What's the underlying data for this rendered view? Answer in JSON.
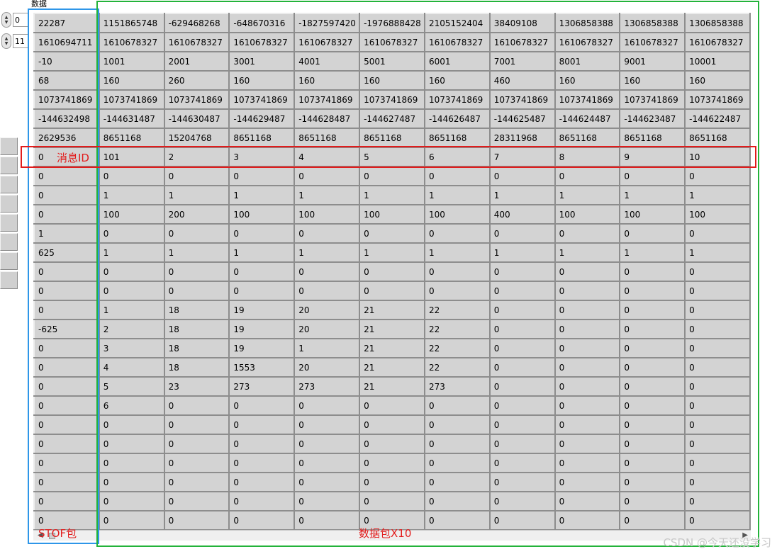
{
  "array": {
    "label": "数据",
    "row_index": "0",
    "col_index": "11"
  },
  "annotations": {
    "message_id": "消息ID",
    "stof_packet": "STOF包",
    "data_packets": "数据包X10"
  },
  "watermark": "CSDN @今天还没学习",
  "rows": [
    [
      "22287",
      "1151865748",
      "-629468268",
      "-648670316",
      "-1827597420",
      "-1976888428",
      "2105152404",
      "38409108",
      "1306858388",
      "1306858388",
      "1306858388"
    ],
    [
      "1610694711",
      "1610678327",
      "1610678327",
      "1610678327",
      "1610678327",
      "1610678327",
      "1610678327",
      "1610678327",
      "1610678327",
      "1610678327",
      "1610678327"
    ],
    [
      "-10",
      "1001",
      "2001",
      "3001",
      "4001",
      "5001",
      "6001",
      "7001",
      "8001",
      "9001",
      "10001"
    ],
    [
      "68",
      "160",
      "260",
      "160",
      "160",
      "160",
      "160",
      "460",
      "160",
      "160",
      "160"
    ],
    [
      "1073741869",
      "1073741869",
      "1073741869",
      "1073741869",
      "1073741869",
      "1073741869",
      "1073741869",
      "1073741869",
      "1073741869",
      "1073741869",
      "1073741869"
    ],
    [
      "-144632498",
      "-144631487",
      "-144630487",
      "-144629487",
      "-144628487",
      "-144627487",
      "-144626487",
      "-144625487",
      "-144624487",
      "-144623487",
      "-144622487"
    ],
    [
      "2629536",
      "8651168",
      "15204768",
      "8651168",
      "8651168",
      "8651168",
      "8651168",
      "28311968",
      "8651168",
      "8651168",
      "8651168"
    ],
    [
      "0",
      "101",
      "2",
      "3",
      "4",
      "5",
      "6",
      "7",
      "8",
      "9",
      "10"
    ],
    [
      "0",
      "0",
      "0",
      "0",
      "0",
      "0",
      "0",
      "0",
      "0",
      "0",
      "0"
    ],
    [
      "0",
      "1",
      "1",
      "1",
      "1",
      "1",
      "1",
      "1",
      "1",
      "1",
      "1"
    ],
    [
      "0",
      "100",
      "200",
      "100",
      "100",
      "100",
      "100",
      "400",
      "100",
      "100",
      "100"
    ],
    [
      "1",
      "0",
      "0",
      "0",
      "0",
      "0",
      "0",
      "0",
      "0",
      "0",
      "0"
    ],
    [
      "625",
      "1",
      "1",
      "1",
      "1",
      "1",
      "1",
      "1",
      "1",
      "1",
      "1"
    ],
    [
      "0",
      "0",
      "0",
      "0",
      "0",
      "0",
      "0",
      "0",
      "0",
      "0",
      "0"
    ],
    [
      "0",
      "0",
      "0",
      "0",
      "0",
      "0",
      "0",
      "0",
      "0",
      "0",
      "0"
    ],
    [
      "0",
      "1",
      "18",
      "19",
      "20",
      "21",
      "22",
      "0",
      "0",
      "0",
      "0"
    ],
    [
      "-625",
      "2",
      "18",
      "19",
      "20",
      "21",
      "22",
      "0",
      "0",
      "0",
      "0"
    ],
    [
      "0",
      "3",
      "18",
      "19",
      "1",
      "21",
      "22",
      "0",
      "0",
      "0",
      "0"
    ],
    [
      "0",
      "4",
      "18",
      "1553",
      "20",
      "21",
      "22",
      "0",
      "0",
      "0",
      "0"
    ],
    [
      "0",
      "5",
      "23",
      "273",
      "273",
      "21",
      "273",
      "0",
      "0",
      "0",
      "0"
    ],
    [
      "0",
      "6",
      "0",
      "0",
      "0",
      "0",
      "0",
      "0",
      "0",
      "0",
      "0"
    ],
    [
      "0",
      "0",
      "0",
      "0",
      "0",
      "0",
      "0",
      "0",
      "0",
      "0",
      "0"
    ],
    [
      "0",
      "0",
      "0",
      "0",
      "0",
      "0",
      "0",
      "0",
      "0",
      "0",
      "0"
    ],
    [
      "0",
      "0",
      "0",
      "0",
      "0",
      "0",
      "0",
      "0",
      "0",
      "0",
      "0"
    ],
    [
      "0",
      "0",
      "0",
      "0",
      "0",
      "0",
      "0",
      "0",
      "0",
      "0",
      "0"
    ],
    [
      "0",
      "0",
      "0",
      "0",
      "0",
      "0",
      "0",
      "0",
      "0",
      "0",
      "0"
    ],
    [
      "0",
      "0",
      "0",
      "0",
      "0",
      "0",
      "0",
      "0",
      "0",
      "0",
      "0"
    ]
  ]
}
